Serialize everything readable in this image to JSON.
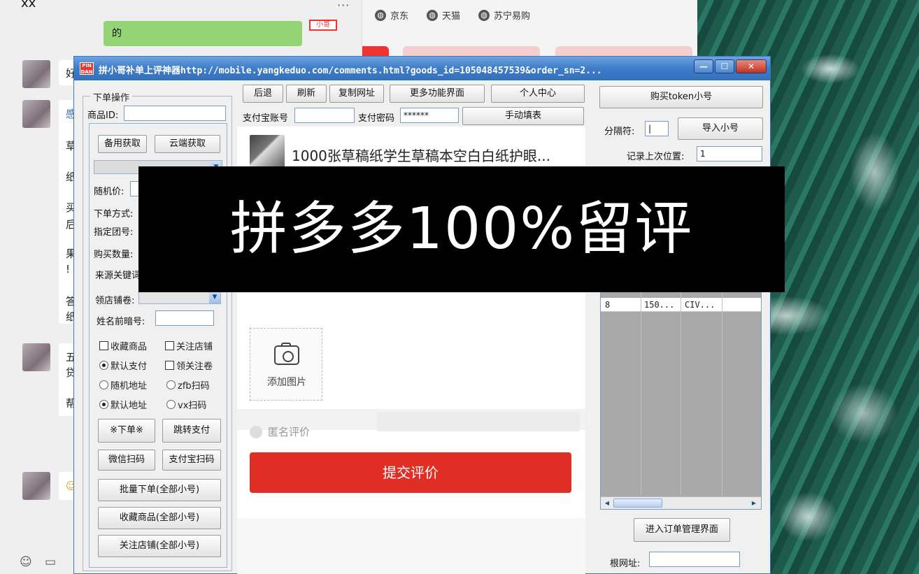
{
  "chat": {
    "title": "xx",
    "dots": "···",
    "green_bubble_text": "的",
    "sticker_text": "小哥",
    "fragments": [
      "好",
      "感",
      "草",
      "纸",
      "买",
      "后",
      "果",
      "!",
      "答",
      "纸",
      "五",
      "贷",
      "帮"
    ]
  },
  "browser": {
    "bookmarks": [
      {
        "label": "京东",
        "icon": "globe-icon"
      },
      {
        "label": "天猫",
        "icon": "globe-icon"
      },
      {
        "label": "苏宁易购",
        "icon": "globe-icon"
      }
    ]
  },
  "tool": {
    "app_icon_text": "PIN DAN",
    "title": "拼小哥补单上评神器http://mobile.yangkeduo.com/comments.html?goods_id=105048457539&order_sn=2...",
    "window_controls": {
      "minimize": "—",
      "maximize": "☐",
      "close": "✕"
    },
    "left": {
      "legend": "下单操作",
      "product_id_label": "商品ID:",
      "btn_backup_fetch": "备用获取",
      "btn_cloud_fetch": "云端获取",
      "random_price_label": "随机价:",
      "order_mode_label": "下单方式:",
      "group_no_label": "指定团号:",
      "qty_label": "购买数量:",
      "source_kw_label": "来源关键词",
      "coupon_label": "领店铺卷:",
      "name_code_label": "姓名前暗号:",
      "options": {
        "fav_product": "收藏商品",
        "follow_shop": "关注店铺",
        "default_pay": "默认支付",
        "get_coupon": "领关注卷",
        "random_addr": "随机地址",
        "zfb_scan": "zfb扫码",
        "default_addr": "默认地址",
        "vx_scan": "vx扫码"
      },
      "btn_order": "※下单※",
      "btn_jump_pay": "跳转支付",
      "btn_wechat_scan": "微信扫码",
      "btn_alipay_scan": "支付宝扫码",
      "btn_batch_order": "批量下单(全部小号)",
      "btn_batch_fav": "收藏商品(全部小号)",
      "btn_batch_follow": "关注店铺(全部小号)"
    },
    "middle": {
      "btn_back": "后退",
      "btn_refresh": "刷新",
      "btn_copy_url": "复制网址",
      "btn_more": "更多功能界面",
      "btn_personal": "个人中心",
      "alipay_account_label": "支付宝账号",
      "alipay_account_value": "",
      "pay_password_label": "支付密码",
      "pay_password_value": "******",
      "btn_manual_fill": "手动填表",
      "product_title": "1000张草稿纸学生草稿本空白白纸护眼...",
      "add_photo_label": "添加图片",
      "anonymous_label": "匿名评价",
      "submit_label": "提交评价"
    },
    "right": {
      "btn_buy_token": "购买token小号",
      "separator_label": "分隔符:",
      "separator_value": "|",
      "btn_import": "导入小号",
      "last_pos_label": "记录上次位置:",
      "last_pos_value": "1",
      "grid_rows": [
        {
          "no": "8",
          "col2": "150...",
          "col3": "CIV..."
        }
      ],
      "btn_order_mgmt": "进入订单管理界面",
      "root_url_label": "根网址:",
      "root_url_value": ""
    }
  },
  "banner": {
    "text": "拼多多100%留评"
  },
  "colors": {
    "accent_red": "#e02e24",
    "title_blue": "#3d7cc9",
    "chat_green": "#95d475"
  }
}
